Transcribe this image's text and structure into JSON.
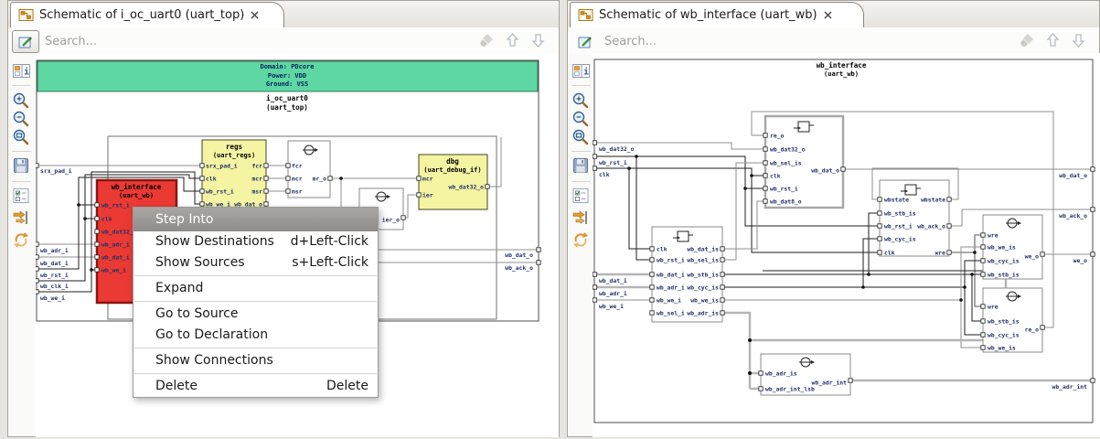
{
  "left": {
    "tab_title": "Schematic of i_oc_uart0 (uart_top)",
    "search_placeholder": "Search...",
    "domain": [
      "Domain: PDcore",
      "Power: VDD",
      "Ground: VSS"
    ],
    "instance": [
      "i_oc_uart0",
      "(uart_top)"
    ],
    "inputs": [
      "srx_pad_i",
      "wb_adr_i",
      "wb_dat_i",
      "wb_rst_i",
      "wb_clk_i",
      "wb_we_i"
    ],
    "outputs": [
      "wb_dat_o",
      "wb_ack_o"
    ],
    "regs": {
      "t1": "regs",
      "t2": "(uart_regs)",
      "l": [
        "srx_pad_i",
        "clk",
        "wb_rst_i",
        "wb_we_i"
      ],
      "r": [
        "fcr",
        "mcr",
        "msr",
        "wb_dat_o"
      ]
    },
    "logic1": {
      "l": [
        "fcr",
        "mcr",
        "msr"
      ],
      "r": [
        "mr_o"
      ]
    },
    "logic2": {
      "r": [
        "ier_o"
      ]
    },
    "dbg": {
      "t1": "dbg",
      "t2": "(uart_debug_if)",
      "l": [
        "mcr",
        "ier"
      ],
      "r": [
        "wb_dat32_o"
      ]
    },
    "wbif": {
      "t1": "wb_interface",
      "t2": "(uart_wb)",
      "l": [
        "wb_rst_i",
        "clk",
        "wb_dat32_",
        "wb_adr_i",
        "wb_dat_i",
        "wb_we_i"
      ]
    },
    "menu": {
      "items": [
        {
          "label": "Step Into",
          "shortcut": ""
        },
        {
          "label": "Show Destinations",
          "shortcut": "d+Left-Click"
        },
        {
          "label": "Show Sources",
          "shortcut": "s+Left-Click"
        },
        {
          "label": "Expand",
          "shortcut": ""
        },
        {
          "label": "Go to Source",
          "shortcut": ""
        },
        {
          "label": "Go to Declaration",
          "shortcut": ""
        },
        {
          "label": "Show Connections",
          "shortcut": ""
        },
        {
          "label": "Delete",
          "shortcut": "Delete"
        }
      ]
    }
  },
  "right": {
    "tab_title": "Schematic of wb_interface (uart_wb)",
    "search_placeholder": "Search...",
    "title": [
      "wb_interface",
      "(uart_wb)"
    ],
    "inputs": [
      "wb_dat32_o",
      "wb_rst_i",
      "clk",
      "wb_dat_i",
      "wb_adr_i",
      "wb_we_i"
    ],
    "outputs": [
      "wb_dat_o",
      "wb_ack_o",
      "we_o",
      "wb_adr_int"
    ],
    "breg": {
      "l": [
        "re_o",
        "wb_dat32_o",
        "wb_sel_is",
        "clk",
        "wb_rst_i",
        "wb_dat8_o"
      ],
      "r": [
        "wb_dat_o"
      ]
    },
    "bstate": {
      "l": [
        "wbstate",
        "wb_stb_is",
        "wb_rst_i",
        "wb_cyc_is",
        "clk"
      ],
      "r": [
        "wbstate",
        "wb_ack_o",
        "wre"
      ]
    },
    "binreg": {
      "l": [
        "clk",
        "wb_rst_i",
        "wb_dat_i",
        "wb_adr_i",
        "wb_we_i",
        "wb_sel_i"
      ],
      "r": [
        "wb_dat_is",
        "wb_sel_is",
        "wb_stb_is",
        "wb_cyc_is",
        "wb_we_is",
        "wb_adr_is"
      ]
    },
    "bwe": {
      "l": [
        "wre",
        "wb_we_is",
        "wb_cyc_is",
        "wb_stb_is"
      ],
      "r": [
        "we_o"
      ]
    },
    "bre": {
      "l": [
        "wre",
        "wb_stb_is",
        "wb_cyc_is",
        "wb_we_is"
      ],
      "r": [
        "re_o"
      ]
    },
    "badr": {
      "l": [
        "wb_adr_is",
        "wb_adr_int_lsb"
      ],
      "r": [
        "wb_adr_int"
      ]
    }
  }
}
